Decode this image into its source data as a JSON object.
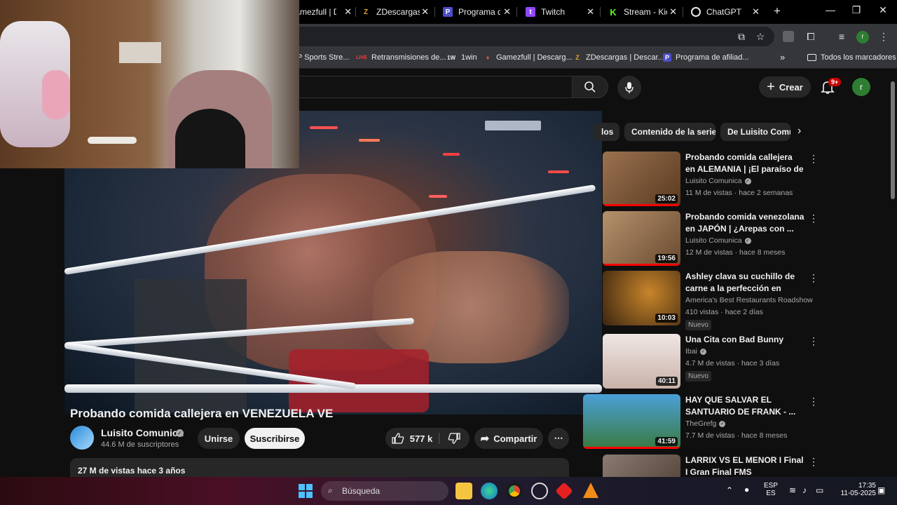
{
  "browser": {
    "tabs": [
      {
        "title": "Gamezfull | D",
        "icon": "gamepad-icon",
        "color": "#c0392b"
      },
      {
        "title": "ZDescargas |",
        "icon": "z-icon",
        "color": "#e2a33b"
      },
      {
        "title": "Programa de",
        "icon": "program-icon",
        "color": "#4a4dc9"
      },
      {
        "title": "Twitch",
        "icon": "twitch-icon",
        "color": "#9146ff"
      },
      {
        "title": "Stream - Kick",
        "icon": "kick-icon",
        "color": "#53fc18"
      },
      {
        "title": "ChatGPT",
        "icon": "chatgpt-icon",
        "color": "#e8eaed"
      }
    ],
    "new_tab": "+",
    "bookmarks": [
      {
        "label": "P Sports Stre...",
        "icon": "sports-icon"
      },
      {
        "label": "Retransmisiones de...",
        "icon": "live-icon",
        "badge": "LIVE"
      },
      {
        "label": "1win",
        "icon": "1win-icon",
        "badge": "1W"
      },
      {
        "label": "Gamezfull | Descarg...",
        "icon": "gamepad-icon"
      },
      {
        "label": "ZDescargas | Descar...",
        "icon": "z-icon"
      },
      {
        "label": "Programa de afiliad...",
        "icon": "program-icon"
      }
    ],
    "bookmarks_overflow": "»",
    "all_bookmarks": "Todos los marcadores",
    "profile_initial": "r"
  },
  "youtube": {
    "create_label": "Crear",
    "notification_count": "9+",
    "avatar_initial": "r"
  },
  "video": {
    "title": "Probando comida callejera en VENEZUELA VE",
    "channel": "Luisito Comunica",
    "subscribers": "44.6 M de suscriptores",
    "join_label": "Unirse",
    "subscribe_label": "Suscribirse",
    "likes": "577 k",
    "share_label": "Compartir",
    "views_age": "27 M de vistas  hace 3 años"
  },
  "chips": [
    "los",
    "Contenido de la serie",
    "De Luisito Comu"
  ],
  "recommendations": [
    {
      "title": "Probando comida callejera en ALEMANIA | ¡El paraíso de la ...",
      "channel": "Luisito Comunica",
      "verified": true,
      "meta": "11 M de vistas · hace 2 semanas",
      "duration": "25:02",
      "badge": "",
      "progress": 1.0,
      "thumb": "#7a5a3a"
    },
    {
      "title": "Probando comida venezolana en JAPÓN | ¿Arepas con ...",
      "channel": "Luisito Comunica",
      "verified": true,
      "meta": "12 M de vistas · hace 8 meses",
      "duration": "19:56",
      "badge": "",
      "progress": 1.0,
      "thumb": "#8a6a4a"
    },
    {
      "title": "Ashley clava su cuchillo de carne a la perfección en Bandi...",
      "channel": "America's Best Restaurants Roadshow",
      "verified": false,
      "meta": "410 vistas · hace 2 días",
      "duration": "10:03",
      "badge": "Nuevo",
      "progress": 0,
      "thumb": "#5a3a1a"
    },
    {
      "title": "Una Cita con Bad Bunny",
      "channel": "Ibai",
      "verified": true,
      "meta": "4.7 M de vistas · hace 3 días",
      "duration": "40:11",
      "badge": "Nuevo",
      "progress": 0,
      "thumb": "#d9c7c0"
    },
    {
      "title": "HAY QUE SALVAR EL SANTUARIO DE FRANK - ...",
      "channel": "TheGrefg",
      "verified": true,
      "meta": "7.7 M de vistas · hace 8 meses",
      "duration": "41:59",
      "badge": "",
      "progress": 1.0,
      "thumb": "#3a8a4a"
    },
    {
      "title": "LARRIX VS EL MENOR I Final I Gran Final FMS Internacional ...",
      "channel": "",
      "verified": false,
      "meta": "",
      "duration": "",
      "badge": "",
      "progress": 0,
      "thumb": "#6a5a50"
    }
  ],
  "taskbar": {
    "search_placeholder": "Búsqueda",
    "lang_top": "ESP",
    "lang_bottom": "ES",
    "time": "17:35",
    "date": "11-05-2025"
  }
}
